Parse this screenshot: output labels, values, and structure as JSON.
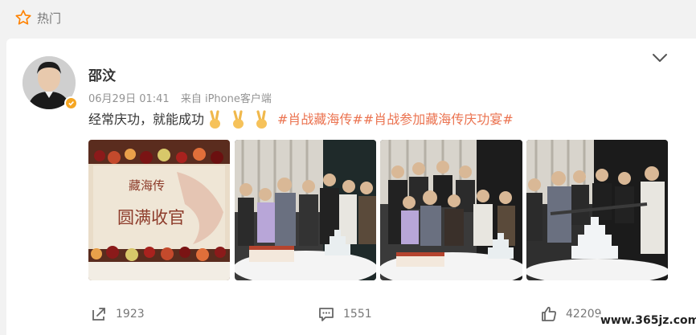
{
  "top": {
    "hot_label": "热门",
    "hot_icon": "star-outline-icon"
  },
  "post": {
    "author": "邵汶",
    "date": "06月29日 01:41",
    "source": "来自 iPhone客户端",
    "text": "经常庆功，就能成功",
    "emojis": [
      "victory-hand-emoji",
      "victory-hand-emoji",
      "victory-hand-emoji"
    ],
    "hashtags": [
      "#肖战藏海传#",
      "#肖战参加藏海传庆功宴#"
    ],
    "photos": [
      {
        "kind": "cake-closeup",
        "cake_text_line1": "藏海传",
        "cake_text_line2": "圆满收官"
      },
      {
        "kind": "group-photo"
      },
      {
        "kind": "group-photo"
      },
      {
        "kind": "cake-cutting-photo"
      }
    ]
  },
  "actions": {
    "share_count": "1923",
    "comment_count": "1551",
    "like_count": "42209"
  },
  "watermark": "www.365jz.com",
  "colors": {
    "hashtag": "#eb7350",
    "meta": "#939393",
    "text": "#333333",
    "background": "#f2f2f2"
  }
}
